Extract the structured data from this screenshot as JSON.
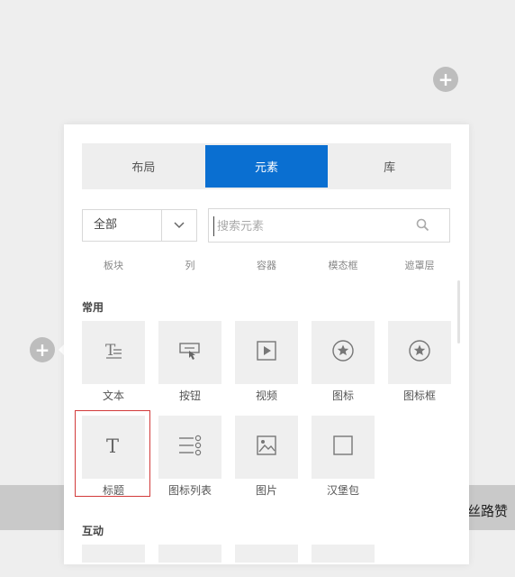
{
  "background_text": "丝路赞",
  "plus_label": "+",
  "tabs": [
    {
      "label": "布局",
      "active": false
    },
    {
      "label": "元素",
      "active": true
    },
    {
      "label": "库",
      "active": false
    }
  ],
  "filter": {
    "value": "全部"
  },
  "search": {
    "placeholder": "搜索元素"
  },
  "filter_chips": [
    "板块",
    "列",
    "容器",
    "模态框",
    "遮罩层"
  ],
  "sections": [
    {
      "title": "常用",
      "items": [
        {
          "label": "文本",
          "icon": "text-icon"
        },
        {
          "label": "按钮",
          "icon": "button-click-icon"
        },
        {
          "label": "视频",
          "icon": "video-play-icon"
        },
        {
          "label": "图标",
          "icon": "star-circle-icon"
        },
        {
          "label": "图标框",
          "icon": "star-circle-box-icon"
        },
        {
          "label": "标题",
          "icon": "heading-t-icon",
          "selected": true
        },
        {
          "label": "图标列表",
          "icon": "icon-list-icon"
        },
        {
          "label": "图片",
          "icon": "image-icon"
        },
        {
          "label": "汉堡包",
          "icon": "square-icon"
        }
      ]
    },
    {
      "title": "互动"
    }
  ],
  "colors": {
    "accent": "#0a6fd1",
    "selection": "#d23a3a"
  }
}
